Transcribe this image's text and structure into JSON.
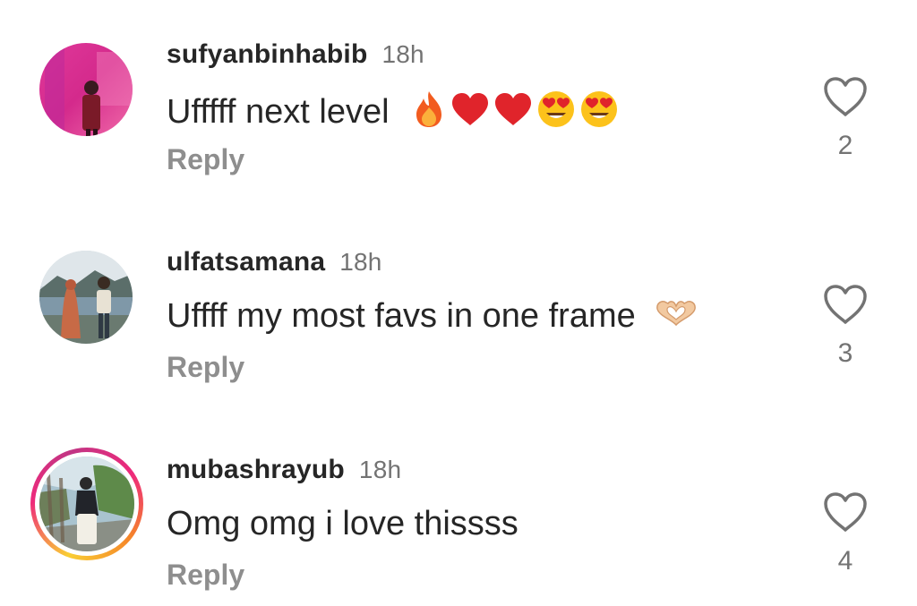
{
  "comments": [
    {
      "username": "sufyanbinhabib",
      "time": "18h",
      "text": "Ufffff next level",
      "emojis": [
        "fire-emoji",
        "red-heart-emoji",
        "red-heart-emoji",
        "heart-eyes-emoji",
        "heart-eyes-emoji"
      ],
      "reply_label": "Reply",
      "likes": "2"
    },
    {
      "username": "ulfatsamana",
      "time": "18h",
      "text": "Uffff my most favs in one frame",
      "emojis": [
        "heart-hands-emoji"
      ],
      "reply_label": "Reply",
      "likes": "3"
    },
    {
      "username": "mubashrayub",
      "time": "18h",
      "text": "Omg omg i love thissss",
      "emojis": [],
      "reply_label": "Reply",
      "likes": "4"
    }
  ],
  "icons": {
    "like": "heart-outline-icon"
  },
  "colors": {
    "text": "#262626",
    "muted": "#737373",
    "reply": "#8e8e8e"
  }
}
